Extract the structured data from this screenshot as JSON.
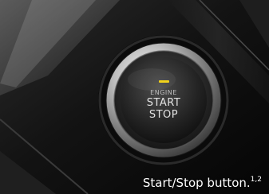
{
  "photo": {
    "subject": "engine start/stop push button",
    "indicator_color": "#f2d31b"
  },
  "button": {
    "line1": "ENGINE",
    "line2": "START",
    "line3": "STOP"
  },
  "caption": {
    "text": "Start/Stop button.",
    "footnote": "1,2"
  }
}
